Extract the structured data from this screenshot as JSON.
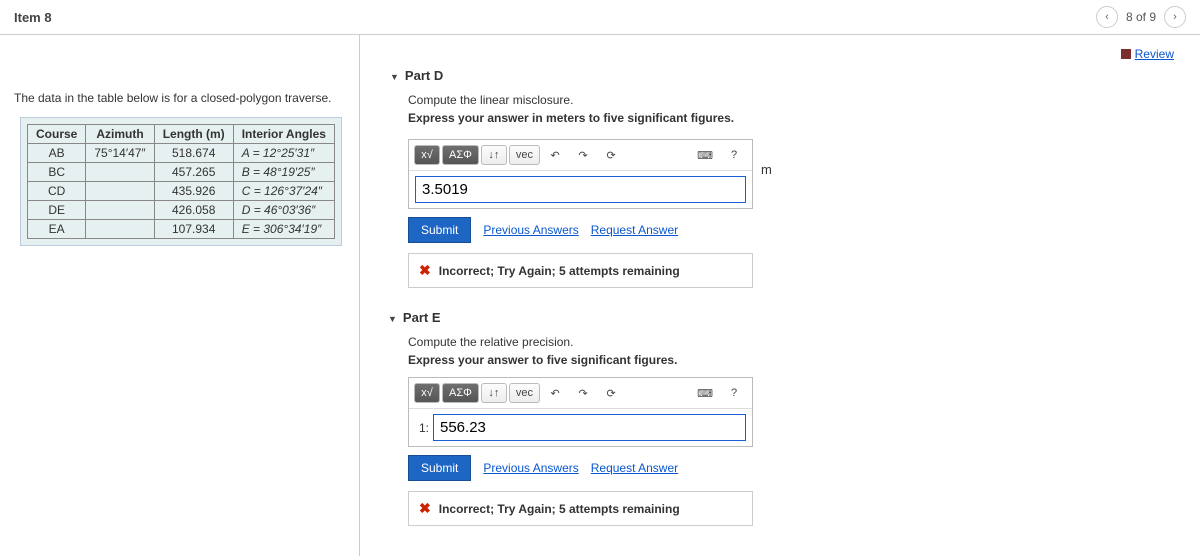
{
  "header": {
    "item_label": "Item 8",
    "page_text": "8 of 9",
    "review_label": "Review"
  },
  "problem": {
    "intro": "The data in the table below is for a closed-polygon traverse.",
    "table": {
      "headers": [
        "Course",
        "Azimuth",
        "Length (m)",
        "Interior Angles"
      ],
      "rows": [
        {
          "course": "AB",
          "azimuth": "75°14′47″",
          "length": "518.674",
          "angle": "A = 12°25′31″"
        },
        {
          "course": "BC",
          "azimuth": "",
          "length": "457.265",
          "angle": "B = 48°19′25″"
        },
        {
          "course": "CD",
          "azimuth": "",
          "length": "435.926",
          "angle": "C = 126°37′24″"
        },
        {
          "course": "DE",
          "azimuth": "",
          "length": "426.058",
          "angle": "D = 46°03′36″"
        },
        {
          "course": "EA",
          "azimuth": "",
          "length": "107.934",
          "angle": "E = 306°34′19″"
        }
      ]
    }
  },
  "toolbar": {
    "template": "x√",
    "greek": "ΑΣΦ",
    "sort": "↓↑",
    "vec": "vec",
    "undo": "↶",
    "redo": "↷",
    "reset": "⟳",
    "keyboard": "⌨",
    "help": "?"
  },
  "partD": {
    "title": "Part D",
    "prompt1": "Compute the linear misclosure.",
    "prompt2": "Express your answer in meters to five significant figures.",
    "value": "3.5019",
    "unit": "m",
    "submit": "Submit",
    "prev_answers": "Previous Answers",
    "req_answer": "Request Answer",
    "feedback": "Incorrect; Try Again; 5 attempts remaining"
  },
  "partE": {
    "title": "Part E",
    "prompt1": "Compute the relative precision.",
    "prompt2": "Express your answer to five significant figures.",
    "prefix": "1:",
    "value": "556.23",
    "submit": "Submit",
    "prev_answers": "Previous Answers",
    "req_answer": "Request Answer",
    "feedback": "Incorrect; Try Again; 5 attempts remaining"
  }
}
